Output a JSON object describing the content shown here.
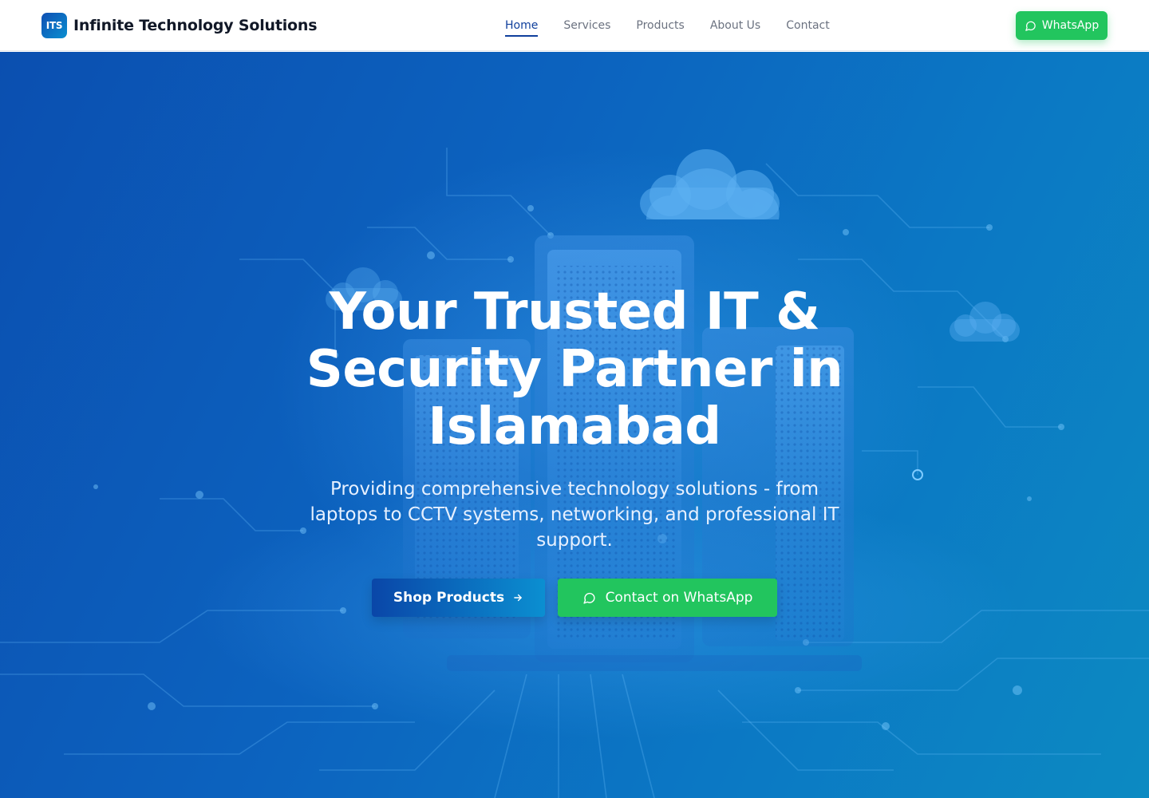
{
  "header": {
    "logo_text": "ITS",
    "brand_name": "Infinite Technology Solutions",
    "nav": [
      {
        "label": "Home",
        "active": true
      },
      {
        "label": "Services",
        "active": false
      },
      {
        "label": "Products",
        "active": false
      },
      {
        "label": "About Us",
        "active": false
      },
      {
        "label": "Contact",
        "active": false
      }
    ],
    "whatsapp_label": "WhatsApp",
    "whatsapp_icon": "chat-bubble-icon"
  },
  "hero": {
    "title": "Your Trusted IT & Security Partner in Islamabad",
    "subtitle": "Providing comprehensive technology solutions - from laptops to CCTV systems, networking, and professional IT support.",
    "shop_label": "Shop Products",
    "shop_icon": "arrow-right-icon",
    "whatsapp_cta_label": "Contact on WhatsApp",
    "whatsapp_cta_icon": "chat-bubble-icon",
    "background_illustration": "server-racks-clouds-circuit-icon"
  },
  "colors": {
    "primary": "#0f3f9c",
    "hero_gradient_start": "#0b4fb0",
    "hero_gradient_end": "#0c8ac2",
    "whatsapp_green": "#22c55e",
    "nav_text": "#6b7280"
  }
}
